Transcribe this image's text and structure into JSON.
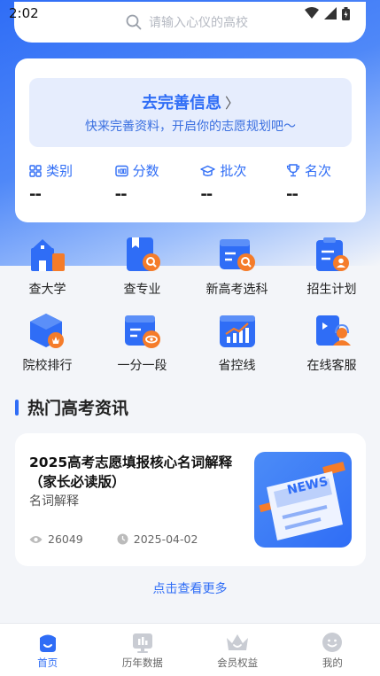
{
  "status": {
    "time": "2:02"
  },
  "search": {
    "placeholder": "请输入心仪的高校"
  },
  "profile": {
    "title": "去完善信息",
    "subtitle": "快来完善资料，开启你的志愿规划吧～",
    "stats": [
      {
        "label": "类别",
        "value": "--",
        "icon": "grid-icon"
      },
      {
        "label": "分数",
        "value": "--",
        "icon": "score-icon"
      },
      {
        "label": "批次",
        "value": "--",
        "icon": "graduation-cap-icon"
      },
      {
        "label": "名次",
        "value": "--",
        "icon": "trophy-icon"
      }
    ]
  },
  "features": [
    {
      "label": "查大学",
      "icon": "school-icon"
    },
    {
      "label": "查专业",
      "icon": "book-search-icon"
    },
    {
      "label": "新高考选科",
      "icon": "subject-search-icon"
    },
    {
      "label": "招生计划",
      "icon": "clipboard-user-icon"
    },
    {
      "label": "院校排行",
      "icon": "ranking-box-icon"
    },
    {
      "label": "一分一段",
      "icon": "score-segment-icon"
    },
    {
      "label": "省控线",
      "icon": "chart-line-icon"
    },
    {
      "label": "在线客服",
      "icon": "customer-service-icon"
    }
  ],
  "news_section": {
    "title": "热门高考资讯",
    "more": "点击查看更多"
  },
  "news": [
    {
      "title": "2025高考志愿填报核心名词解释（家长必读版）",
      "category": "名词解释",
      "views": "26049",
      "date": "2025-04-02",
      "thumb_text": "NEWS"
    }
  ],
  "tabs": [
    {
      "label": "首页",
      "icon": "home-icon",
      "active": true
    },
    {
      "label": "历年数据",
      "icon": "data-icon",
      "active": false
    },
    {
      "label": "会员权益",
      "icon": "crown-icon",
      "active": false
    },
    {
      "label": "我的",
      "icon": "profile-icon",
      "active": false
    }
  ],
  "colors": {
    "accent": "#2f6df6",
    "accent_light": "#e6edfd",
    "icon_orange": "#f57c2a"
  }
}
